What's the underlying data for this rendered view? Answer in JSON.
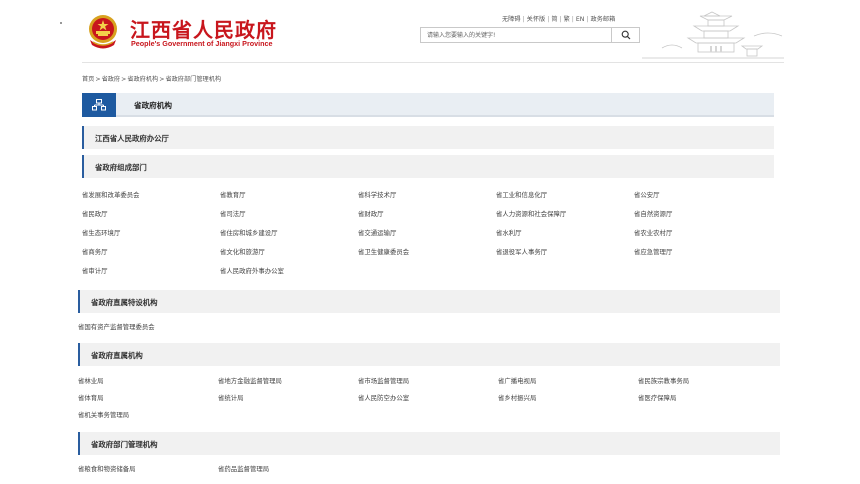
{
  "header": {
    "title": "江西省人民政府",
    "subtitle": "People's Government of Jiangxi Province",
    "top_links": [
      "无障碍",
      "关怀版",
      "简",
      "繁",
      "EN",
      "政务邮箱"
    ],
    "search_placeholder": "请输入您要输入的关键字!",
    "search_icon": "search-icon",
    "emblem_icon": "national-emblem-icon",
    "landmark_icon": "tengwang-pavilion-icon"
  },
  "breadcrumb": [
    "首页",
    "省政府",
    "省政府机构",
    "省政府部门管理机构"
  ],
  "main": {
    "title": "省政府机构",
    "icon": "org-chart-icon",
    "accent": "#1e5aa0"
  },
  "sections": [
    {
      "label": "江西省人民政府办公厅",
      "items": []
    },
    {
      "label": "省政府组成部门",
      "items": [
        "省发展和改革委员会",
        "省教育厅",
        "省科学技术厅",
        "省工业和信息化厅",
        "省公安厅",
        "省民政厅",
        "省司法厅",
        "省财政厅",
        "省人力资源和社会保障厅",
        "省自然资源厅",
        "省生态环境厅",
        "省住房和城乡建设厅",
        "省交通运输厅",
        "省水利厅",
        "省农业农村厅",
        "省商务厅",
        "省文化和旅游厅",
        "省卫生健康委员会",
        "省退役军人事务厅",
        "省应急管理厅",
        "省审计厅",
        "省人民政府外事办公室"
      ]
    },
    {
      "label": "省政府直属特设机构",
      "items": [
        "省国有资产监督管理委员会"
      ]
    },
    {
      "label": "省政府直属机构",
      "items": [
        "省林业局",
        "省地方金融监督管理局",
        "省市场监督管理局",
        "省广播电视局",
        "省民族宗教事务局",
        "省体育局",
        "省统计局",
        "省人民防空办公室",
        "省乡村振兴局",
        "省医疗保障局",
        "省机关事务管理局"
      ]
    },
    {
      "label": "省政府部门管理机构",
      "items": [
        "省粮食和物资储备局",
        "省药品监督管理局"
      ]
    }
  ],
  "colors": {
    "brand_red": "#c8161d",
    "accent_blue": "#1e5aa0"
  }
}
